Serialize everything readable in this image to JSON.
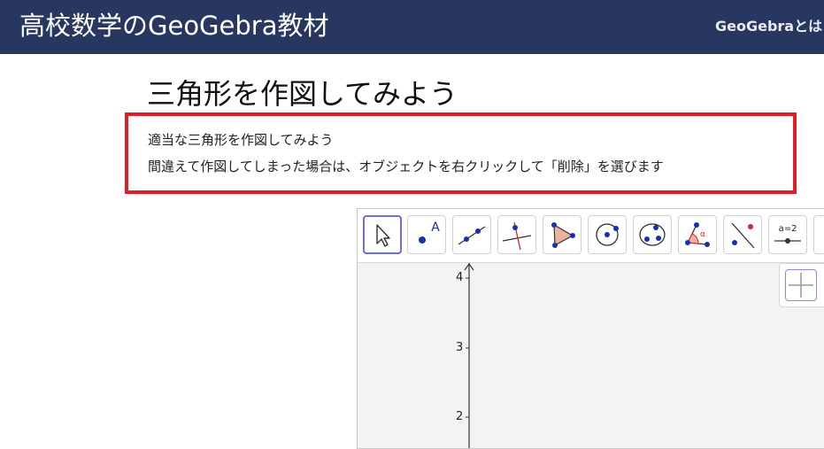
{
  "header": {
    "site_title": "高校数学のGeoGebra教材",
    "nav_link": "GeoGebraとは"
  },
  "page": {
    "title": "三角形を作図してみよう"
  },
  "note": {
    "line1": "適当な三角形を作図してみよう",
    "line2": "間違えて作図してしまった場合は、オブジェクトを右クリックして「削除」を選びます"
  },
  "applet": {
    "toolbar": [
      {
        "name": "move-tool",
        "icon": "arrow-icon",
        "selected": true
      },
      {
        "name": "point-tool",
        "icon": "point-icon",
        "label": "A"
      },
      {
        "name": "line-tool",
        "icon": "line-icon"
      },
      {
        "name": "perpendicular-line-tool",
        "icon": "perpendicular-icon"
      },
      {
        "name": "polygon-tool",
        "icon": "polygon-icon"
      },
      {
        "name": "circle-center-point-tool",
        "icon": "circle-icon"
      },
      {
        "name": "circle-three-points-tool",
        "icon": "circle-three-points-icon"
      },
      {
        "name": "angle-tool",
        "icon": "angle-icon",
        "label": "α"
      },
      {
        "name": "reflect-tool",
        "icon": "reflect-icon"
      },
      {
        "name": "slider-tool",
        "icon": "slider-icon",
        "label": "a=2"
      },
      {
        "name": "more-tool",
        "icon": "more-icon"
      }
    ],
    "y_ticks": [
      "4",
      "3",
      "2"
    ],
    "colors": {
      "point": "#1a2fb0",
      "polygon_fill": "#e8b3a0",
      "accent": "#6e70d8",
      "header_bg": "#283760",
      "note_border": "#e01e2a"
    }
  }
}
